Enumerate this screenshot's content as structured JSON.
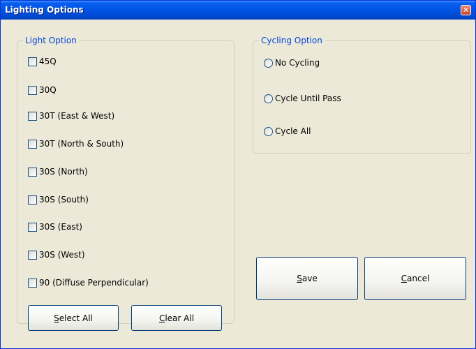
{
  "window": {
    "title": "Lighting Options"
  },
  "light_group": {
    "legend": "Light Option",
    "options": [
      {
        "label": "45Q",
        "checked": false
      },
      {
        "label": "30Q",
        "checked": false
      },
      {
        "label": "30T (East & West)",
        "checked": false
      },
      {
        "label": "30T (North & South)",
        "checked": false
      },
      {
        "label": "30S (North)",
        "checked": false
      },
      {
        "label": "30S (South)",
        "checked": false
      },
      {
        "label": "30S (East)",
        "checked": false
      },
      {
        "label": "30S (West)",
        "checked": false
      },
      {
        "label": "90 (Diffuse Perpendicular)",
        "checked": false
      }
    ],
    "select_all": {
      "mnemonic": "S",
      "rest": "elect All"
    },
    "clear_all": {
      "mnemonic": "C",
      "rest": "lear All"
    }
  },
  "cycling_group": {
    "legend": "Cycling Option",
    "options": [
      {
        "label": "No Cycling",
        "selected": false
      },
      {
        "label": "Cycle Until Pass",
        "selected": false
      },
      {
        "label": "Cycle All",
        "selected": false
      }
    ]
  },
  "save": {
    "mnemonic": "S",
    "rest": "ave"
  },
  "cancel": {
    "mnemonic": "C",
    "rest": "ancel"
  },
  "colors": {
    "titlebar": "#0054e3",
    "face": "#ece9d8",
    "legend": "#0046d5"
  }
}
